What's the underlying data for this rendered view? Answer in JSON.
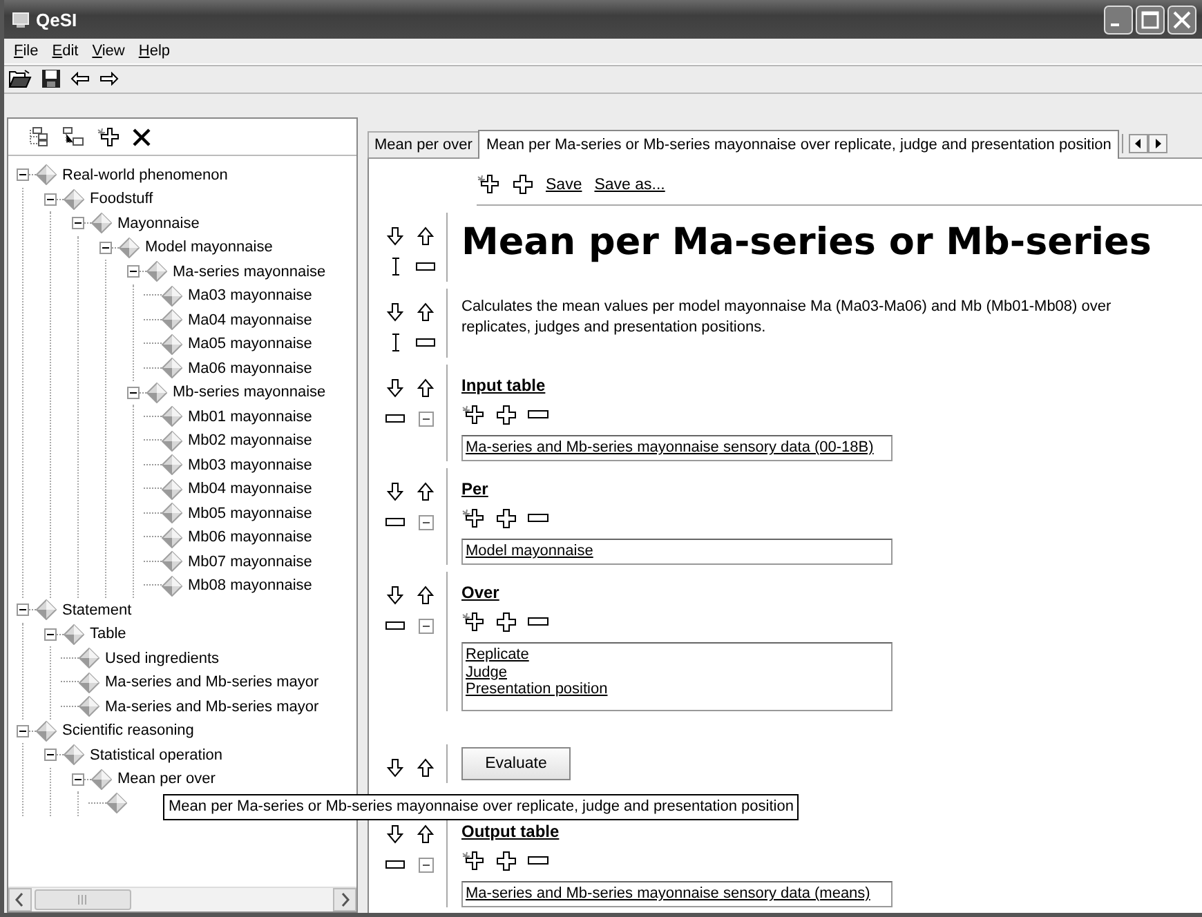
{
  "window": {
    "title": "QeSI"
  },
  "menu": [
    {
      "label": "File"
    },
    {
      "label": "Edit"
    },
    {
      "label": "View"
    },
    {
      "label": "Help"
    }
  ],
  "tree": [
    {
      "label": "Real-world phenomenon",
      "expanded": true,
      "children": [
        {
          "label": "Foodstuff",
          "expanded": true,
          "children": [
            {
              "label": "Mayonnaise",
              "expanded": true,
              "children": [
                {
                  "label": "Model mayonnaise",
                  "expanded": true,
                  "children": [
                    {
                      "label": "Ma-series mayonnaise",
                      "expanded": true,
                      "children": [
                        {
                          "label": "Ma03 mayonnaise"
                        },
                        {
                          "label": "Ma04 mayonnaise"
                        },
                        {
                          "label": "Ma05 mayonnaise"
                        },
                        {
                          "label": "Ma06 mayonnaise"
                        }
                      ]
                    },
                    {
                      "label": "Mb-series mayonnaise",
                      "expanded": true,
                      "children": [
                        {
                          "label": "Mb01 mayonnaise"
                        },
                        {
                          "label": "Mb02 mayonnaise"
                        },
                        {
                          "label": "Mb03 mayonnaise"
                        },
                        {
                          "label": "Mb04 mayonnaise"
                        },
                        {
                          "label": "Mb05 mayonnaise"
                        },
                        {
                          "label": "Mb06 mayonnaise"
                        },
                        {
                          "label": "Mb07 mayonnaise"
                        },
                        {
                          "label": "Mb08 mayonnaise"
                        }
                      ]
                    }
                  ]
                }
              ]
            }
          ]
        }
      ]
    },
    {
      "label": "Statement",
      "expanded": true,
      "children": [
        {
          "label": "Table",
          "expanded": true,
          "children": [
            {
              "label": "Used ingredients"
            },
            {
              "label": "Ma-series and Mb-series mayor"
            },
            {
              "label": "Ma-series and Mb-series mayor"
            }
          ]
        }
      ]
    },
    {
      "label": "Scientific reasoning",
      "expanded": true,
      "children": [
        {
          "label": "Statistical operation",
          "expanded": true,
          "children": [
            {
              "label": "Mean per over",
              "expanded": true,
              "children": [
                {
                  "tooltip": "Mean per Ma-series or Mb-series mayonnaise over replicate, judge and presentation position"
                }
              ]
            }
          ]
        }
      ]
    }
  ],
  "tabs": [
    {
      "label": "Mean per over",
      "selected": false
    },
    {
      "label": "Mean per Ma-series or Mb-series mayonnaise over replicate, judge and presentation position",
      "selected": true
    }
  ],
  "document": {
    "actions": [
      "Save",
      "Save as..."
    ],
    "title": "Mean per Ma-series or Mb-series",
    "description": "Calculates the mean values per model mayonnaise Ma (Ma03-Ma06) and Mb (Mb01-Mb08) over replicates, judges and presentation positions.",
    "sections": [
      {
        "kind": "field",
        "heading": "Input table",
        "items": [
          "Ma-series and Mb-series mayonnaise sensory data (00-18B)"
        ]
      },
      {
        "kind": "field",
        "heading": "Per",
        "items": [
          "Model mayonnaise"
        ]
      },
      {
        "kind": "list",
        "heading": "Over",
        "items": [
          "Replicate",
          "Judge",
          "Presentation position"
        ]
      },
      {
        "kind": "button",
        "label": "Evaluate"
      },
      {
        "kind": "field",
        "heading": "Output table",
        "items": [
          "Ma-series and Mb-series mayonnaise sensory data (means)"
        ]
      }
    ]
  }
}
